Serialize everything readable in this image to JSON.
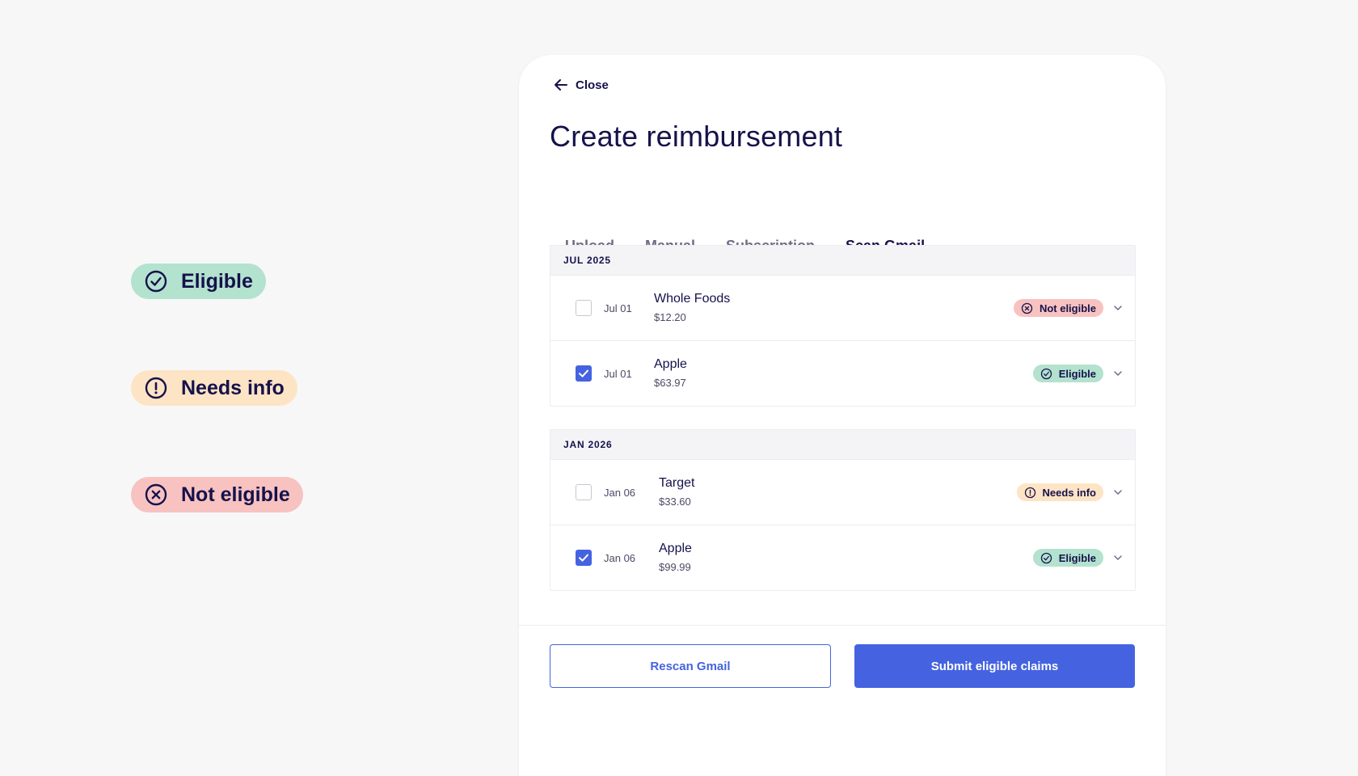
{
  "legend": {
    "eligible": "Eligible",
    "needs_info": "Needs info",
    "not_eligible": "Not eligible"
  },
  "close_label": "Close",
  "title": "Create reimbursement",
  "tabs": [
    {
      "label": "Upload"
    },
    {
      "label": "Manual"
    },
    {
      "label": "Subscription"
    },
    {
      "label": "Scan Gmail"
    }
  ],
  "active_tab": "Scan Gmail",
  "groups": [
    {
      "header": "JUL 2025",
      "rows": [
        {
          "date": "Jul 01",
          "merchant": "Whole Foods",
          "amount": "$12.20",
          "status": "Not eligible",
          "checked": false
        },
        {
          "date": "Jul 01",
          "merchant": "Apple",
          "amount": "$63.97",
          "status": "Eligible",
          "checked": true
        }
      ]
    },
    {
      "header": "JAN 2026",
      "rows": [
        {
          "date": "Jan 06",
          "merchant": "Target",
          "amount": "$33.60",
          "status": "Needs info",
          "checked": false
        },
        {
          "date": "Jan 06",
          "merchant": "Apple",
          "amount": "$99.99",
          "status": "Eligible",
          "checked": true
        }
      ]
    }
  ],
  "buttons": {
    "rescan": "Rescan Gmail",
    "submit": "Submit eligible claims"
  },
  "colors": {
    "accent": "#4563e0",
    "text": "#15124b",
    "eligible_bg": "#b3e2cf",
    "needs_info_bg": "#fde4c4",
    "not_eligible_bg": "#f7c2c0"
  },
  "icons": {
    "eligible": "check-circle-icon",
    "needs_info": "exclamation-circle-icon",
    "not_eligible": "x-circle-icon",
    "close": "arrow-left-icon",
    "expand": "chevron-down-icon",
    "checkbox": "checkmark-icon"
  }
}
